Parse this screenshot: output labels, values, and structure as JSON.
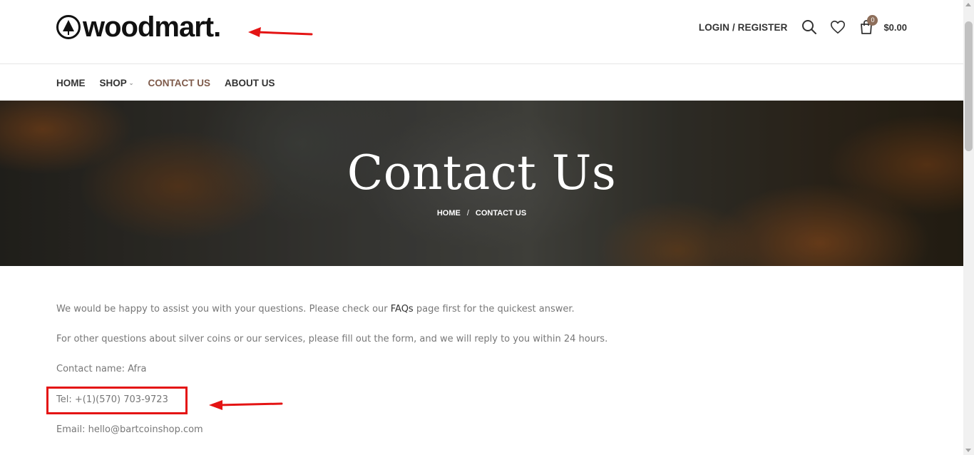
{
  "brand": {
    "name": "woodmart.",
    "logo_icon": "tree-icon"
  },
  "header": {
    "login_label": "LOGIN / REGISTER",
    "cart_count": "0",
    "cart_total": "$0.00",
    "icons": [
      "search-icon",
      "heart-icon",
      "shopping-bag-icon"
    ]
  },
  "nav": {
    "items": [
      {
        "label": "HOME"
      },
      {
        "label": "SHOP"
      },
      {
        "label": "CONTACT US"
      },
      {
        "label": "ABOUT US"
      }
    ]
  },
  "hero": {
    "title": "Contact Us",
    "breadcrumb_home": "HOME",
    "breadcrumb_sep": "/",
    "breadcrumb_current": "CONTACT US"
  },
  "content": {
    "intro_before": "We would be happy to assist you with your questions. Please check our ",
    "faq_link": "FAQs",
    "intro_after": " page first for the quickest answer.",
    "line2": "For other questions about silver coins or our services, please fill out the form, and we will reply to you within 24 hours.",
    "contact_name": "Contact name: Afra",
    "tel": "Tel: +(1)(570) 703-9723",
    "email": "Email: hello@bartcoinshop.com"
  },
  "colors": {
    "accent_nav": "#7e5a4a",
    "annotation_red": "#e41414"
  }
}
